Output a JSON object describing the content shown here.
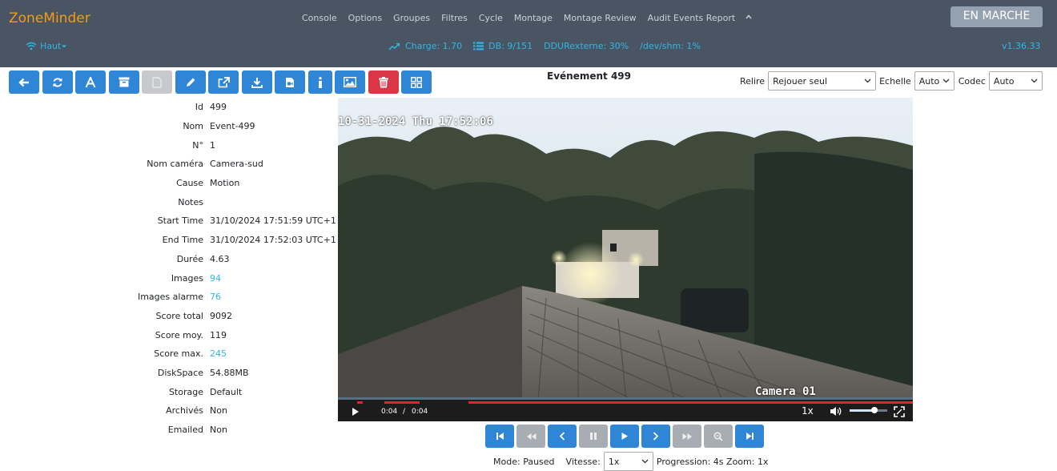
{
  "brand": "ZoneMinder",
  "nav": [
    "Console",
    "Options",
    "Groupes",
    "Filtres",
    "Cycle",
    "Montage",
    "Montage Review",
    "Audit Events Report"
  ],
  "run_state": "EN MARCHE",
  "bandwidth": "Haut",
  "stats": {
    "load": "Charge: 1.70",
    "db": "DB: 9/151",
    "disk": "DDURexterne: 30%",
    "shm": "/dev/shm: 1%"
  },
  "version": "v1.36.33",
  "toolbar": [
    "back",
    "refresh",
    "rename",
    "archive",
    "unarchive",
    "edit",
    "export",
    "download",
    "video-export",
    "info",
    "frames",
    "delete",
    "montage"
  ],
  "event_title": "Evénement 499",
  "replay": {
    "label": "Relire",
    "value": "Rejouer seul",
    "scale_label": "Echelle",
    "scale_value": "Auto",
    "codec_label": "Codec",
    "codec_value": "Auto"
  },
  "details": [
    {
      "key": "Id",
      "value": "499",
      "link": false
    },
    {
      "key": "Nom",
      "value": "Event-499",
      "link": false
    },
    {
      "key": "N°",
      "value": "1",
      "link": false
    },
    {
      "key": "Nom caméra",
      "value": "Camera-sud",
      "link": false
    },
    {
      "key": "Cause",
      "value": "Motion",
      "link": false
    },
    {
      "key": "Notes",
      "value": "",
      "link": false
    },
    {
      "key": "Start Time",
      "value": "31/10/2024 17:51:59 UTC+1",
      "link": false
    },
    {
      "key": "End Time",
      "value": "31/10/2024 17:52:03 UTC+1",
      "link": false
    },
    {
      "key": "Durée",
      "value": "4.63",
      "link": false
    },
    {
      "key": "Images",
      "value": "94",
      "link": true
    },
    {
      "key": "Images alarme",
      "value": "76",
      "link": true
    },
    {
      "key": "Score total",
      "value": "9092",
      "link": false
    },
    {
      "key": "Score moy.",
      "value": "119",
      "link": false
    },
    {
      "key": "Score max.",
      "value": "245",
      "link": true
    },
    {
      "key": "DiskSpace",
      "value": "54.88MB",
      "link": false
    },
    {
      "key": "Storage",
      "value": "Default",
      "link": false
    },
    {
      "key": "Archivés",
      "value": "Non",
      "link": false
    },
    {
      "key": "Emailed",
      "value": "Non",
      "link": false
    }
  ],
  "video": {
    "osd_time": "10-31-2024 Thu 17:52:06",
    "osd_camera": "Camera 01",
    "current": "0:04",
    "separator": "/",
    "duration": "0:04",
    "rate": "1x",
    "volume": 0.65
  },
  "mode": {
    "label": "Mode:",
    "value": "Paused",
    "speed_label": "Vitesse:",
    "speed_value": "1x",
    "progress": "Progression: 4s",
    "zoom": "Zoom: 1x"
  },
  "colors": {
    "header": "#495563",
    "brand": "#f39c12",
    "link": "#2fb6e7",
    "button": "#2f86d7",
    "danger": "#dc3545"
  }
}
